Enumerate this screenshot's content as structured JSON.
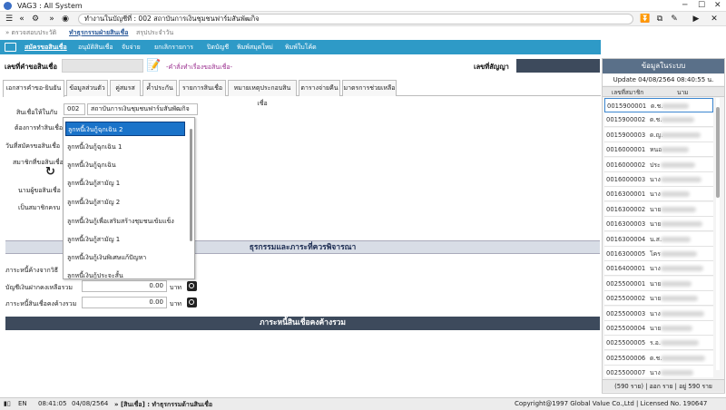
{
  "window": {
    "title": "VAG3 : All System",
    "working_text": "ทำงานในบัญชีที่ : 002  สถาบันการเงินชุมชนฟาร์มสันพัฒกิจ"
  },
  "toolbar": {
    "icons": [
      "menu-icon",
      "back-icon",
      "settings-icon",
      "forward-icon",
      "home-icon",
      "download-icon",
      "open-external-icon",
      "edit-icon",
      "play-icon",
      "close-icon"
    ]
  },
  "breadcrumb": {
    "item1": "» ตรวจสอบประวัติ",
    "item2": "ทำธุรกรรมฝ่ายสินเชื่อ",
    "item3": "สรุปประจำวัน"
  },
  "menubar": {
    "items": [
      "สมัครขอสินเชื่อ",
      "อนุมัติสินเชื่อ",
      "จับจ่าย",
      "ยกเลิกรายการ",
      "ปิดบัญชี",
      "พิมพ์สมุดใหม่",
      "พิมพ์ใบโค้ด"
    ]
  },
  "request": {
    "label": "เลขที่คำขอสินเชื่อ",
    "link": "-คำสั่งทำเรื่องขอสินเชื่อ-",
    "contract_label": "เลขที่สัญญา"
  },
  "tabs": [
    "เอกสารคำขอ-ยินยัน",
    "ข้อมูลส่วนตัว",
    "คู่สมรส",
    "ค้ำประกัน",
    "รายการสินเชื่อ",
    "หมายเหตุประกอบสินเชื่อ",
    "ตารางจ่ายคืน",
    "มาตรการช่วยเหลือ"
  ],
  "form": {
    "loan_label": "สินเชื่อให้ในกับ",
    "loan_code": "002",
    "loan_org": "สถาบันการเงินชุมชนฟาร์มสันพัฒกิจ",
    "field2": "ต้องการทำสินเชื่อ",
    "field3": "วันที่สมัครขอสินเชื่อ",
    "field4": "สมาชิกที่ขอสินเชื่อ",
    "field5": "นามผู้ขอสินเชื่อ",
    "field6": "เป็นสมาชิกครบ"
  },
  "dropdown": {
    "options": [
      "ลูกหนี้เงินกู้ฉุกเฉิน 2",
      "ลูกหนี้เงินกู้ฉุกเฉิน 1",
      "ลูกหนี้เงินกู้ฉุกเฉิน",
      "ลูกหนี้เงินกู้สามัญ 1",
      "ลูกหนี้เงินกู้สามัญ 2",
      "ลูกหนี้เงินกู้เพื่อเสริมสร้างชุมชนเข้มแข็ง",
      "ลูกหนี้เงินกู้สามัญ 1",
      "ลูกหนี้เงินกู้เงินพิเศษแก้ปัญหา",
      "ลูกหนี้เงินกู้ประจะสั้น"
    ]
  },
  "section1": {
    "title": "ธุรกรรมและภาระที่ควรพิจารณา",
    "row1_label": "ภาระหนี้ค้างจากวิธี",
    "row2_label": "บัญชีเงินฝากคงเหลือรวม",
    "row2_value": "0.00",
    "row2_unit": "บาท",
    "row3_label": "ภาระหนี้สินเชื่อคงค้างรวม",
    "row3_value": "0.00",
    "row3_unit": "บาท"
  },
  "section2": {
    "title": "ภาระหนี้สินเชื่อคงค้างรวม"
  },
  "rightpanel": {
    "title": "ข้อมูลในระบบ",
    "update": "Update  04/08/2564 08:40:55 น.",
    "col_code": "เลขที่สมาชิก",
    "col_name": "นาม",
    "rows": [
      {
        "code": "0015900001",
        "name": "ด.ช."
      },
      {
        "code": "0015900002",
        "name": "ด.ช."
      },
      {
        "code": "0015900003",
        "name": "ด.ญ."
      },
      {
        "code": "0016000001",
        "name": "หนอ"
      },
      {
        "code": "0016000002",
        "name": "ประ"
      },
      {
        "code": "0016000003",
        "name": "นาง"
      },
      {
        "code": "0016300001",
        "name": "นาง"
      },
      {
        "code": "0016300002",
        "name": "นาย"
      },
      {
        "code": "0016300003",
        "name": "นาย"
      },
      {
        "code": "0016300004",
        "name": "น.ส."
      },
      {
        "code": "0016300005",
        "name": "โคร"
      },
      {
        "code": "0016400001",
        "name": "นาง"
      },
      {
        "code": "0025500001",
        "name": "นาย"
      },
      {
        "code": "0025500002",
        "name": "นาย"
      },
      {
        "code": "0025500003",
        "name": "นาง"
      },
      {
        "code": "0025500004",
        "name": "นาย"
      },
      {
        "code": "0025500005",
        "name": "ร.อ."
      },
      {
        "code": "0025500006",
        "name": "ด.ช."
      },
      {
        "code": "0025500007",
        "name": "นาง"
      },
      {
        "code": "0025500008",
        "name": "นาย"
      }
    ],
    "footer": "(590 ราย)  |  ออก  ราย  |  อยู่ 590 ราย"
  },
  "status": {
    "lang": "EN",
    "time": "08:41:05",
    "date": "04/08/2564",
    "path": "» [สินเชื่อ] : ทำธุรกรรมด้านสินเชื่อ",
    "copyright": "Copyright@1997 Global Value Co.,Ltd | Licensed No. 190647"
  },
  "colors": {
    "menubar": "#2e9ac7",
    "section_header": "#2e5fa8",
    "section_dark": "#3d4a5c",
    "selection": "#1a73c9",
    "panel_header": "#5a7089"
  }
}
